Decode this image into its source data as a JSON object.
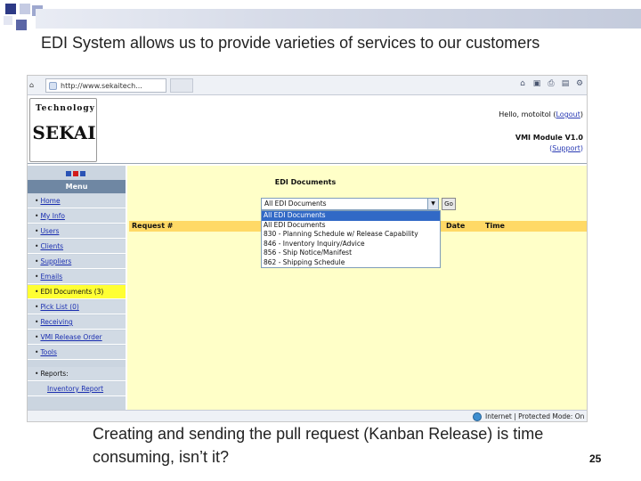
{
  "slide": {
    "heading": "EDI System allows us to provide varieties of services to our customers",
    "caption": "Creating and sending the pull request (Kanban Release) is time consuming, isn’t it?",
    "number": "25"
  },
  "browser": {
    "home_label": "⌂",
    "url_text": "http://www.sekaitech...",
    "icons": [
      "home-icon",
      "feeds-icon",
      "print-icon",
      "page-icon",
      "tools-icon"
    ],
    "status": "Internet | Protected Mode: On"
  },
  "site": {
    "logo_top": "Technology",
    "logo_name": "SEKAI",
    "hello_prefix": "Hello, motoitol (",
    "logout": "Logout",
    "hello_suffix": ")",
    "module": "VMI Module V1.0",
    "support_open": "(",
    "support": "Support",
    "support_close": ")"
  },
  "menu": {
    "title": "Menu",
    "items": [
      {
        "label": "Home",
        "active": false
      },
      {
        "label": "My Info",
        "active": false
      },
      {
        "label": "Users",
        "active": false
      },
      {
        "label": "Clients",
        "active": false
      },
      {
        "label": "Suppliers",
        "active": false
      },
      {
        "label": "Emails",
        "active": false
      },
      {
        "label": "EDI Documents (3)",
        "active": true
      },
      {
        "label": "Pick List (0)",
        "active": false
      },
      {
        "label": "Receiving",
        "active": false
      },
      {
        "label": "VMI Release Order",
        "active": false
      },
      {
        "label": "Tools",
        "active": false
      },
      {
        "label": "Reports:",
        "active": false
      },
      {
        "label": "Inventory Report",
        "active": false
      }
    ]
  },
  "main": {
    "title": "EDI Documents",
    "select_value": "All EDI Documents",
    "go_label": "Go",
    "columns": [
      "Request #",
      "Date",
      "Time"
    ],
    "dropdown_options": [
      "All EDI Documents",
      "All EDI Documents",
      "830 - Planning Schedule w/ Release Capability",
      "846 - Inventory Inquiry/Advice",
      "856 - Ship Notice/Manifest",
      "862 - Shipping Schedule"
    ]
  },
  "colors": {
    "accent": "#3169c6",
    "main_bg": "#ffffc8",
    "header_row": "#ffd966",
    "menu_active": "#ffff33"
  }
}
